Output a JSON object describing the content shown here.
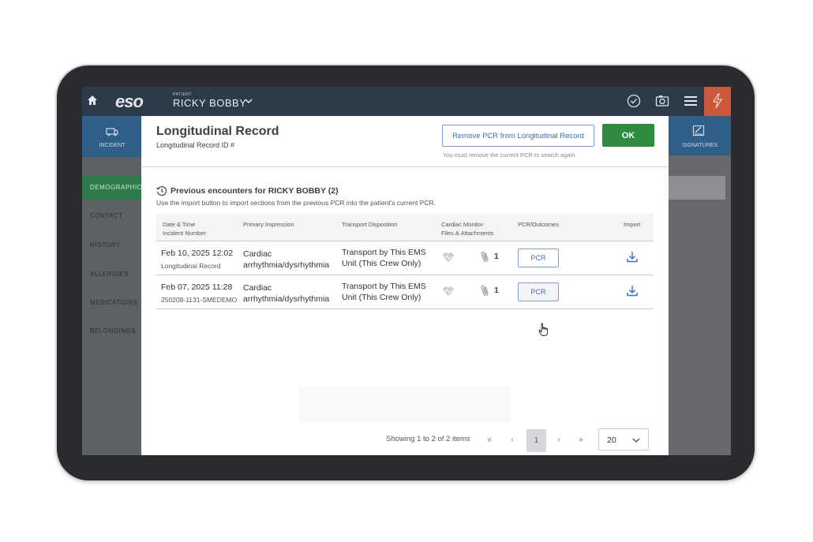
{
  "app": {
    "logo": "eso",
    "patient_caption": "PATIENT",
    "patient_name": "RICKY BOBBY"
  },
  "left_nav": {
    "incident_label": "INCIDENT",
    "items": [
      "DEMOGRAPHIC",
      "CONTACT",
      "HISTORY",
      "ALLERGIES",
      "MEDICATIONS",
      "BELONGINGS"
    ],
    "active": "DEMOGRAPHIC"
  },
  "right_nav": {
    "signatures_label": "SIGNATURES"
  },
  "modal": {
    "title": "Longitudinal Record",
    "subtitle": "Longitudinal Record ID #",
    "remove_button": "Remove PCR from Longitudinal Record",
    "remove_note": "You must remove the current PCR to search again.",
    "ok_button": "OK",
    "section_title": "Previous encounters for RICKY BOBBY (2)",
    "section_desc": "Use the import button to import sections from the previous PCR into the patient's current PCR.",
    "columns": {
      "date_line1": "Date & Time",
      "date_line2": "Incident Number",
      "primary_impression": "Primary Impression",
      "transport_disposition": "Transport Disposition",
      "cardiac_line1": "Cardiac Monitor",
      "cardiac_line2": "Files & Attachments",
      "pcr_outcomes": "PCR/Outcomes",
      "import": "Import"
    },
    "rows": [
      {
        "date": "Feb 10, 2025 12:02",
        "incident": "Longitudinal Record",
        "primary_impression": "Cardiac arrhythmia/dysrhythmia",
        "transport_disposition": "Transport by This EMS Unit (This Crew Only)",
        "attachments": "1",
        "pcr_button": "PCR"
      },
      {
        "date": "Feb 07, 2025 11:28",
        "incident": "250208-1131-SMEDEMO",
        "primary_impression": "Cardiac arrhythmia/dysrhythmia",
        "transport_disposition": "Transport by This EMS Unit (This Crew Only)",
        "attachments": "1",
        "pcr_button": "PCR"
      }
    ],
    "pagination": {
      "showing": "Showing 1 to 2 of 2 items",
      "first": "«",
      "prev": "‹",
      "current_page": "1",
      "next": "›",
      "last": "»",
      "page_size": "20"
    }
  },
  "colors": {
    "accent_blue": "#3d70b5",
    "ok_green": "#2e8b3d",
    "topbar": "#2c3a4a",
    "flash_button": "#c9583d"
  },
  "icons": [
    "home-icon",
    "chevron-down-icon",
    "check-circle-icon",
    "camera-icon",
    "hamburger-menu-icon",
    "lightning-icon",
    "ambulance-icon",
    "signature-icon",
    "history-clock-icon",
    "heart-monitor-icon",
    "paperclip-icon",
    "download-icon",
    "pointer-cursor-icon"
  ]
}
